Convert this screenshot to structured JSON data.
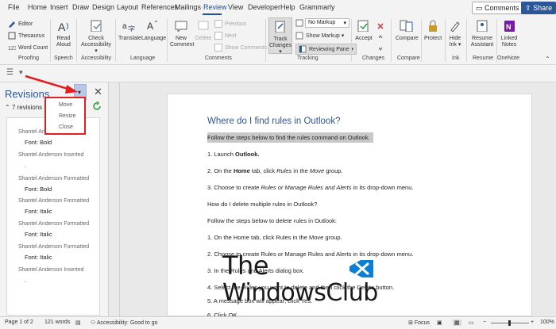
{
  "menubar": {
    "items": [
      "File",
      "Home",
      "Insert",
      "Draw",
      "Design",
      "Layout",
      "References",
      "Mailings",
      "Review",
      "View",
      "Developer",
      "Help",
      "Grammarly"
    ],
    "active": "Review",
    "comments_btn": "Comments",
    "share_btn": "Share"
  },
  "ribbon": {
    "proofing": {
      "editor": "Editor",
      "thesaurus": "Thesaurus",
      "word_count": "Word Count",
      "label": "Proofing"
    },
    "speech": {
      "read_aloud_1": "Read",
      "read_aloud_2": "Aloud",
      "label": "Speech"
    },
    "accessibility": {
      "check_1": "Check",
      "check_2": "Accessibility ▾",
      "label": "Accessibility"
    },
    "language": {
      "translate": "Translate",
      "language": "Language",
      "label": "Language"
    },
    "comments": {
      "new_1": "New",
      "new_2": "Comment",
      "delete": "Delete",
      "previous": "Previous",
      "next": "Next",
      "show": "Show Comments",
      "label": "Comments"
    },
    "tracking": {
      "track_1": "Track",
      "track_2": "Changes ▾",
      "markup_select": "No Markup",
      "show_markup": "Show Markup ▾",
      "reviewing_pane": "Reviewing Pane ▾",
      "label": "Tracking"
    },
    "changes": {
      "accept": "Accept",
      "label": "Changes"
    },
    "compare": {
      "compare": "Compare",
      "label": "Compare"
    },
    "protect": {
      "protect": "Protect"
    },
    "ink": {
      "hide_1": "Hide",
      "hide_2": "Ink ▾",
      "label": "Ink"
    },
    "resume": {
      "resume_1": "Resume",
      "resume_2": "Assistant",
      "label": "Resume"
    },
    "onenote": {
      "linked_1": "Linked",
      "linked_2": "Notes",
      "label": "OneNote"
    }
  },
  "pane": {
    "title": "Revisions",
    "count": "7 revisions",
    "context_menu": [
      "Move",
      "Resize",
      "Close"
    ],
    "revisions": [
      {
        "author": "Shantel Anderson Formatted",
        "detail": "Font: Bold"
      },
      {
        "author": "Shantel Anderson Inserted",
        "detail": "."
      },
      {
        "author": "Shantel Anderson Formatted",
        "detail": "Font: Bold"
      },
      {
        "author": "Shantel Anderson Formatted",
        "detail": "Font: Italic"
      },
      {
        "author": "Shantel Anderson Formatted",
        "detail": "Font: Italic"
      },
      {
        "author": "Shantel Anderson Formatted",
        "detail": "Font: Italic"
      },
      {
        "author": "Shantel Anderson Inserted",
        "detail": "."
      }
    ],
    "first_author_visible": "Shantel An"
  },
  "document": {
    "title": "Where do I find rules in Outlook?",
    "highlight": "Follow the steps below to find the rules command on Outlook.",
    "l1_a": "1. Launch ",
    "l1_b": "Outlook.",
    "l2_a": "2. On the ",
    "l2_b": "Home",
    "l2_c": " tab, click ",
    "l2_d": "Rules",
    "l2_e": " in the ",
    "l2_f": "Move",
    "l2_g": " group.",
    "l3_a": "3. Choose to create ",
    "l3_b": "Rules or Manage Rules and Alerts",
    "l3_c": " in its drop-down menu.",
    "q2": "How do I delete multiple rules in Outlook?",
    "p2": "Follow the steps below to delete rules in Outlook:",
    "s1": "1. On the Home tab, click Rules in the Move group.",
    "s2": "2. Choose to create Rules or Manage Rules and Alerts in its drop-down menu.",
    "s3": "3. In the Rules and Alerts dialog box.",
    "s4": "4. Select the Rules you want to delete and then click the Delete button.",
    "s5": "5. A message box will appear; click Yes.",
    "s6": "6. Click OK."
  },
  "watermark": {
    "line1": "The",
    "line2": "WindowsClub"
  },
  "status": {
    "page": "Page 1 of 2",
    "words": "121 words",
    "accessibility": "Accessibility: Good to go",
    "focus": "Focus",
    "zoom": "100%"
  }
}
